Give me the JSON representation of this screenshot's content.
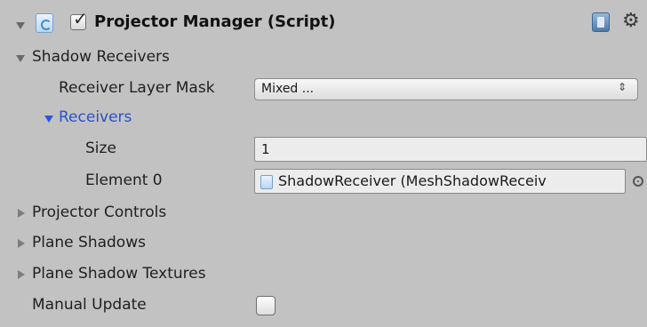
{
  "component": {
    "title": "Projector Manager (Script)",
    "enabled": true
  },
  "shadow_receivers": {
    "label": "Shadow Receivers",
    "receiver_layer_mask": {
      "label": "Receiver Layer Mask",
      "value": "Mixed ...",
      "arrows": "⇕"
    },
    "receivers": {
      "label": "Receivers",
      "size_label": "Size",
      "size_value": "1",
      "element0_label": "Element 0",
      "element0_value": "ShadowReceiver (MeshShadowReceiv"
    }
  },
  "sections": {
    "projector_controls": "Projector Controls",
    "plane_shadows": "Plane Shadows",
    "plane_shadow_textures": "Plane Shadow Textures"
  },
  "manual_update": {
    "label": "Manual Update",
    "checked": false
  },
  "icons": {
    "foldout_expanded": "arrow-down-icon",
    "foldout_collapsed": "arrow-right-icon",
    "script": "script-icon",
    "help": "book-icon",
    "settings": "gear-icon",
    "object_picker": "object-picker-icon"
  },
  "colors": {
    "background": "#c2c2c2",
    "foldout_highlight": "#2a52c8"
  }
}
